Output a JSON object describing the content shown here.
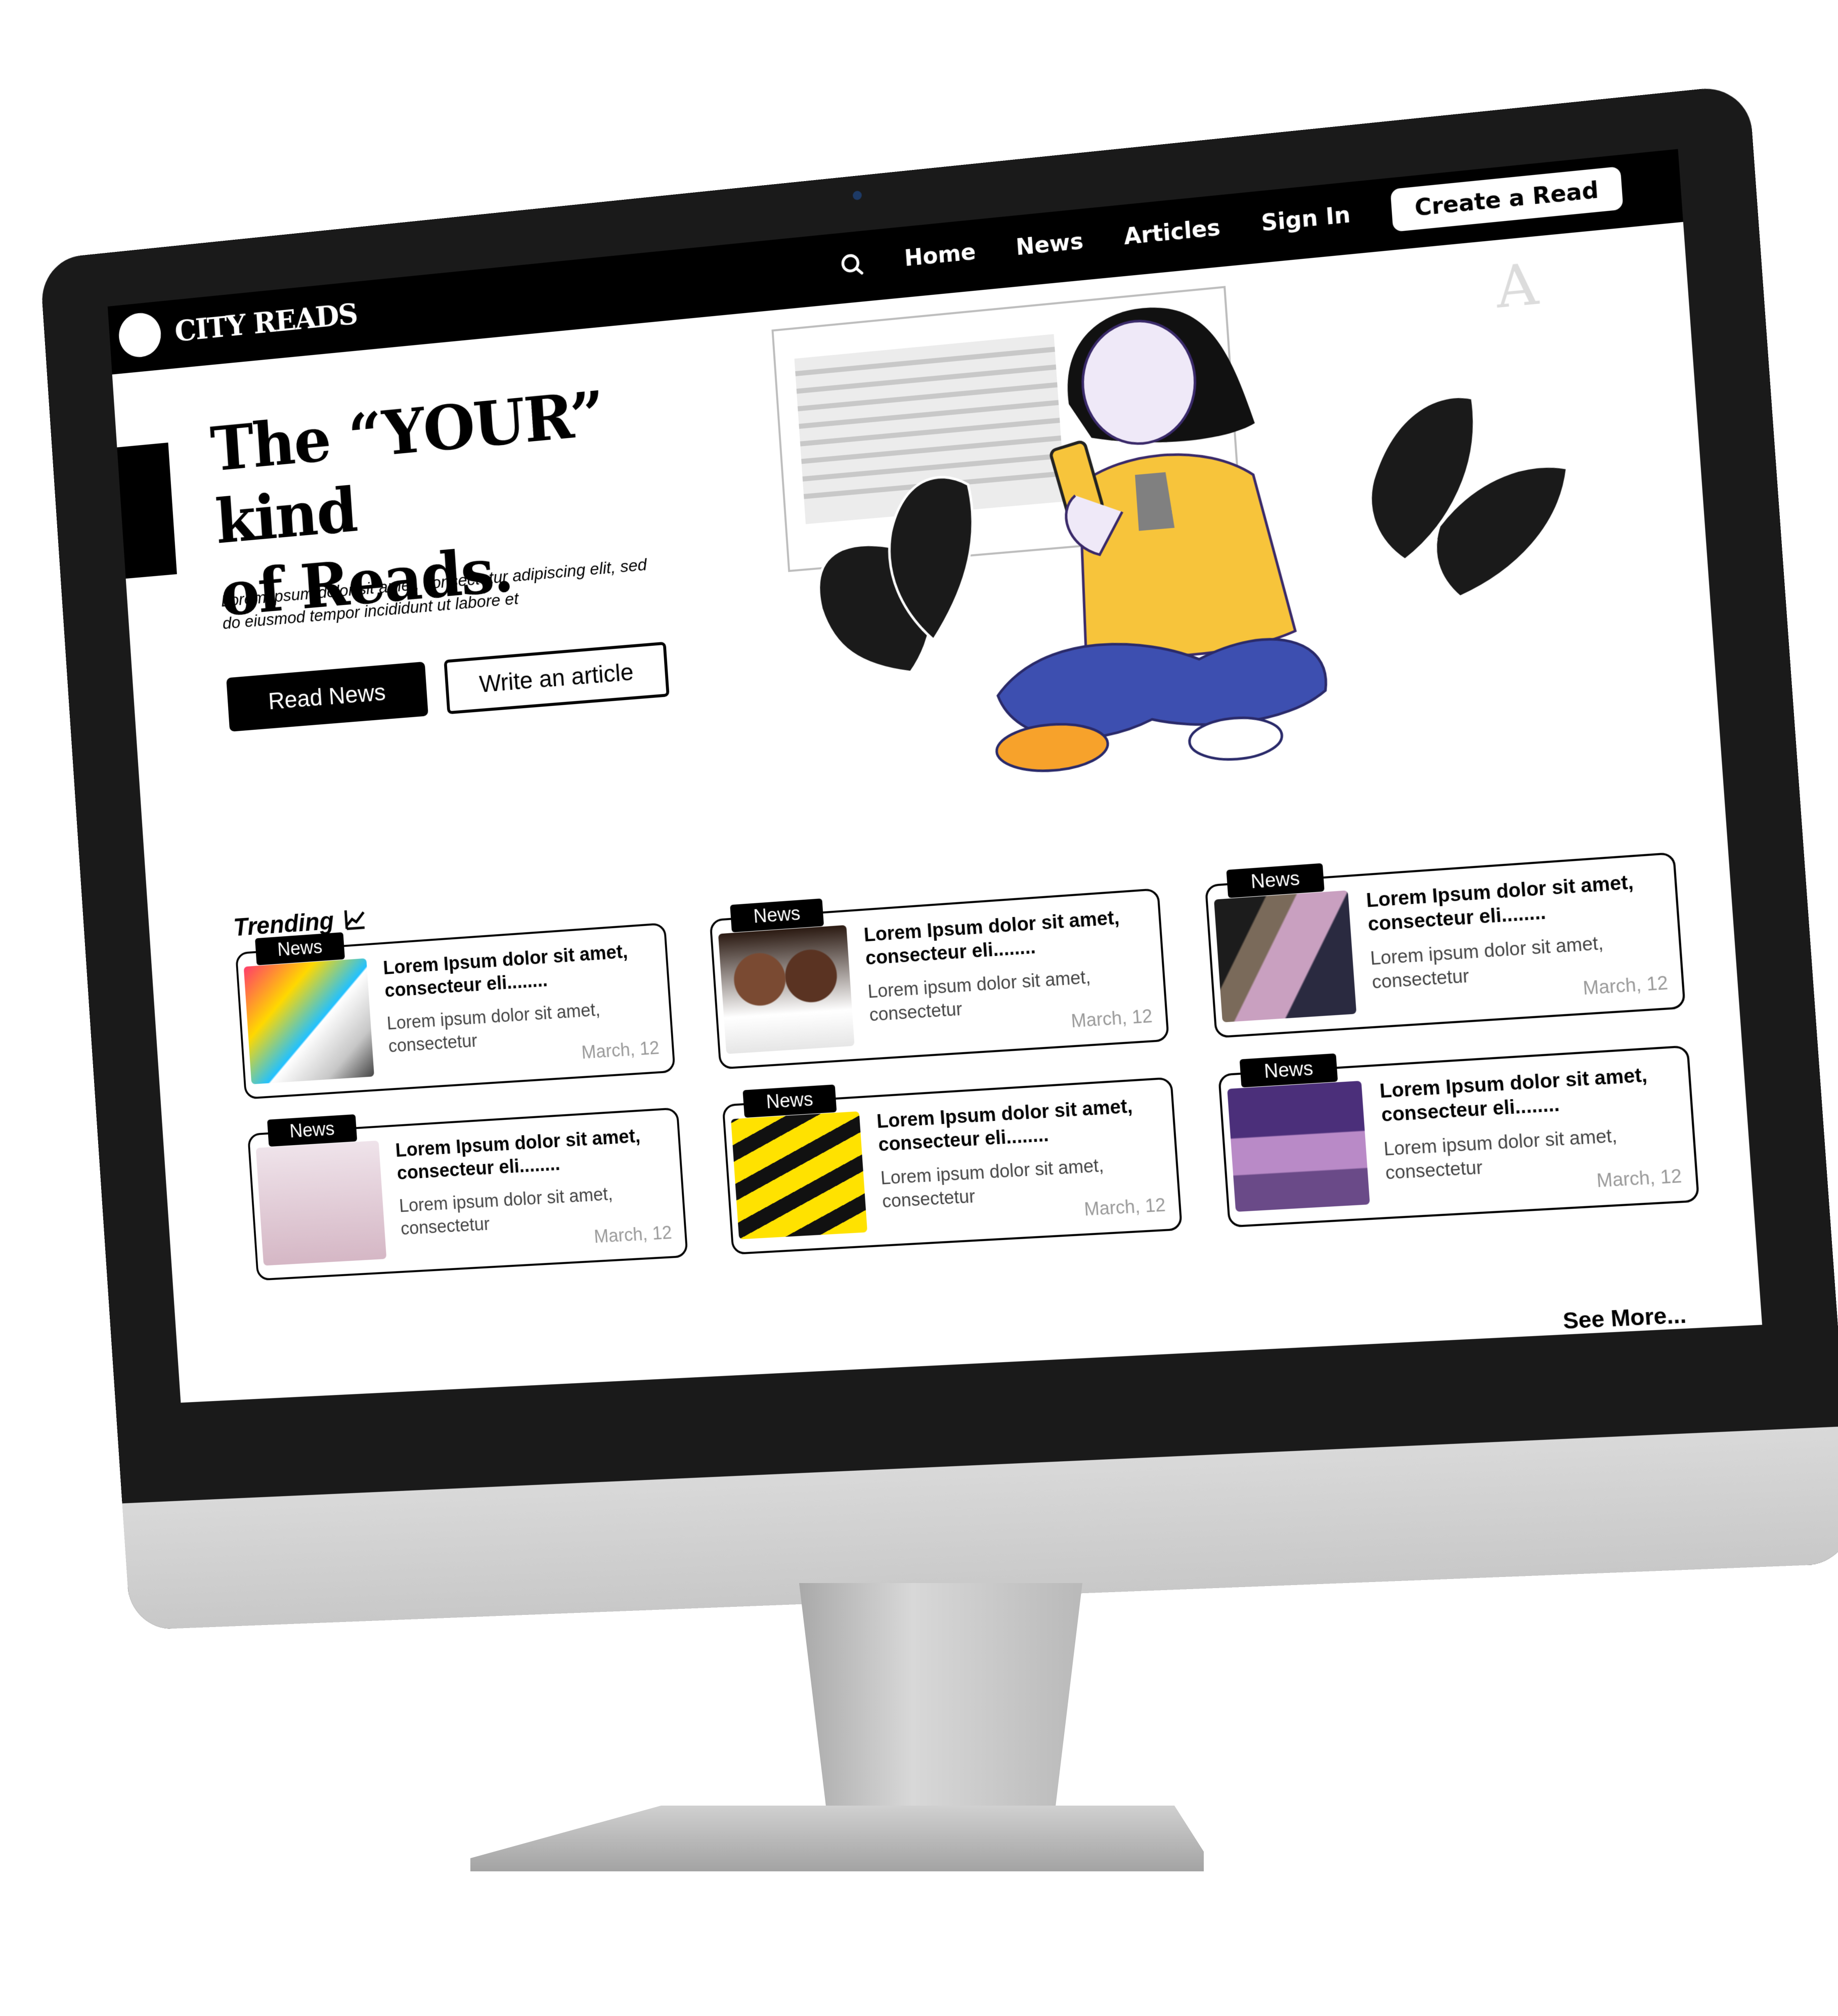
{
  "site": {
    "brand_name": "CITY READS"
  },
  "nav": {
    "search_icon": "search-icon",
    "items": [
      "Home",
      "News",
      "Articles",
      "Sign In"
    ],
    "create_label": "Create a  Read"
  },
  "hero": {
    "title_line1": "The “YOUR” kind",
    "title_line2": "of Reads.",
    "text": "Lorem ipsum dolor sit amet, consectetur adipiscing elit, sed do eiusmod tempor incididunt ut labore et",
    "read_button": "Read News",
    "write_button": "Write an article"
  },
  "trending": {
    "title": "Trending",
    "icon": "trend-chart-icon",
    "cards": [
      {
        "badge": "News",
        "title": "Lorem Ipsum dolor sit amet, consecteur eli........",
        "text": "Lorem ipsum dolor sit amet, consectetur",
        "date": "March, 12"
      },
      {
        "badge": "News",
        "title": "Lorem Ipsum dolor sit amet, consecteur eli........",
        "text": "Lorem ipsum dolor sit amet, consectetur",
        "date": "March, 12"
      },
      {
        "badge": "News",
        "title": "Lorem Ipsum dolor sit amet, consecteur eli........",
        "text": "Lorem ipsum dolor sit amet, consectetur",
        "date": "March, 12"
      },
      {
        "badge": "News",
        "title": "Lorem Ipsum dolor sit amet, consecteur eli........",
        "text": "Lorem ipsum dolor sit amet, consectetur",
        "date": "March, 12"
      },
      {
        "badge": "News",
        "title": "Lorem Ipsum dolor sit amet, consecteur eli........",
        "text": "Lorem ipsum dolor sit amet, consectetur",
        "date": "March, 12"
      },
      {
        "badge": "News",
        "title": "Lorem Ipsum dolor sit amet, consecteur eli........",
        "text": "Lorem ipsum dolor sit amet, consectetur",
        "date": "March, 12"
      }
    ],
    "see_more": "See More..."
  },
  "colors": {
    "primary": "#000000",
    "background": "#ffffff",
    "accent_yellow": "#f7c43b",
    "accent_blue": "#3d4fb0"
  }
}
